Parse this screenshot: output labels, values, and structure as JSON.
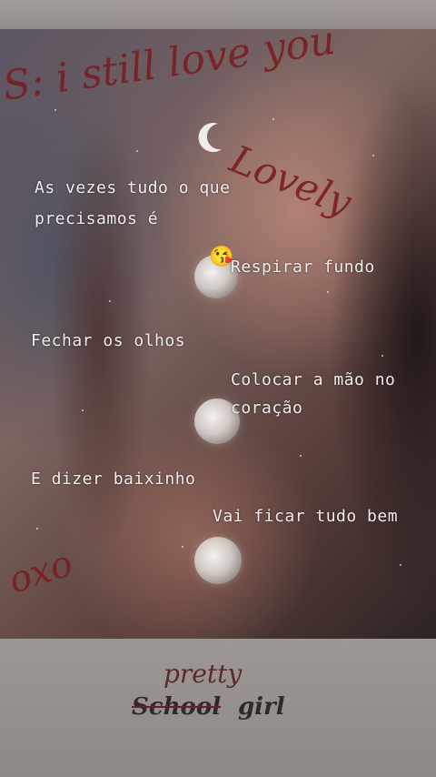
{
  "overlay_script": {
    "headline": "S: i still love you",
    "signature": "Lovely",
    "doodle": "oxo"
  },
  "captions": [
    "As vezes tudo o que",
    "precisamos é",
    "Respirar fundo",
    "Fechar os olhos",
    "Colocar a mão no",
    "coração",
    "E dizer baixinho",
    "Vai ficar tudo bem"
  ],
  "emoji": "😘",
  "brand": {
    "pretty": "pretty",
    "school": "School",
    "girl": "girl"
  },
  "colors": {
    "accent_red": "#7a1e20",
    "caption_text": "#f2eeee"
  }
}
